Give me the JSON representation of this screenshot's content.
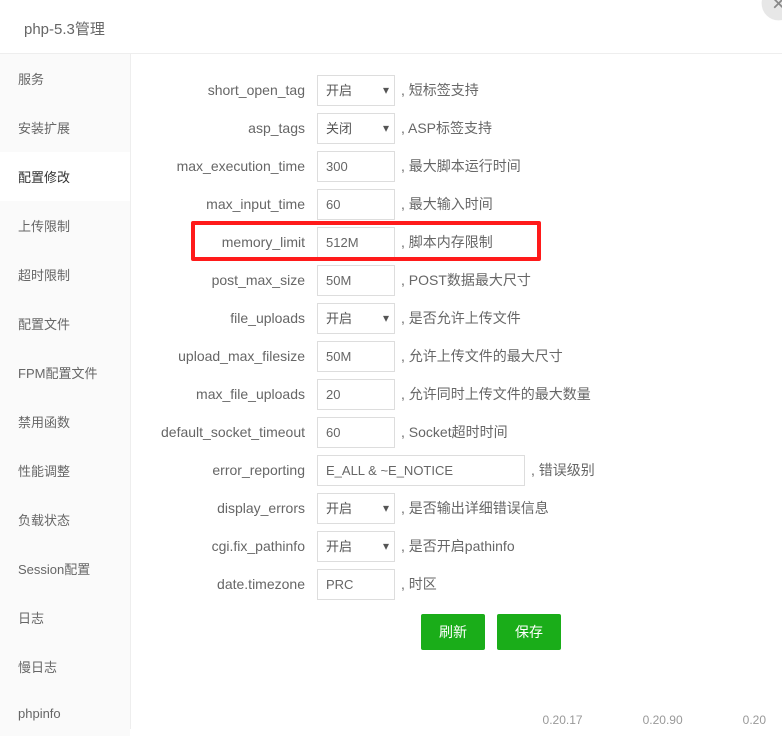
{
  "window": {
    "title": "php-5.3管理"
  },
  "sidebar": {
    "items": [
      {
        "label": "服务"
      },
      {
        "label": "安装扩展"
      },
      {
        "label": "配置修改"
      },
      {
        "label": "上传限制"
      },
      {
        "label": "超时限制"
      },
      {
        "label": "配置文件"
      },
      {
        "label": "FPM配置文件"
      },
      {
        "label": "禁用函数"
      },
      {
        "label": "性能调整"
      },
      {
        "label": "负载状态"
      },
      {
        "label": "Session配置"
      },
      {
        "label": "日志"
      },
      {
        "label": "慢日志"
      },
      {
        "label": "phpinfo"
      }
    ],
    "active_index": 2
  },
  "form": {
    "rows": [
      {
        "key": "short_open_tag",
        "type": "select",
        "value": "开启",
        "desc": ", 短标签支持"
      },
      {
        "key": "asp_tags",
        "type": "select",
        "value": "关闭",
        "desc": ", ASP标签支持"
      },
      {
        "key": "max_execution_time",
        "type": "input",
        "value": "300",
        "desc": ", 最大脚本运行时间"
      },
      {
        "key": "max_input_time",
        "type": "input",
        "value": "60",
        "desc": ", 最大输入时间"
      },
      {
        "key": "memory_limit",
        "type": "input",
        "value": "512M",
        "desc": ", 脚本内存限制",
        "highlight": true
      },
      {
        "key": "post_max_size",
        "type": "input",
        "value": "50M",
        "desc": ", POST数据最大尺寸"
      },
      {
        "key": "file_uploads",
        "type": "select",
        "value": "开启",
        "desc": ", 是否允许上传文件"
      },
      {
        "key": "upload_max_filesize",
        "type": "input",
        "value": "50M",
        "desc": ", 允许上传文件的最大尺寸"
      },
      {
        "key": "max_file_uploads",
        "type": "input",
        "value": "20",
        "desc": ", 允许同时上传文件的最大数量"
      },
      {
        "key": "default_socket_timeout",
        "type": "input",
        "value": "60",
        "desc": ", Socket超时时间"
      },
      {
        "key": "error_reporting",
        "type": "input-wide",
        "value": "E_ALL & ~E_NOTICE",
        "desc": ", 错误级别"
      },
      {
        "key": "display_errors",
        "type": "select",
        "value": "开启",
        "desc": ", 是否输出详细错误信息"
      },
      {
        "key": "cgi.fix_pathinfo",
        "type": "select",
        "value": "开启",
        "desc": ", 是否开启pathinfo"
      },
      {
        "key": "date.timezone",
        "type": "input",
        "value": "PRC",
        "desc": ", 时区"
      }
    ]
  },
  "buttons": {
    "refresh": "刷新",
    "save": "保存"
  },
  "footer": {
    "n1": "0.20.17",
    "n2": "0.20.90",
    "n3": "0.20"
  }
}
